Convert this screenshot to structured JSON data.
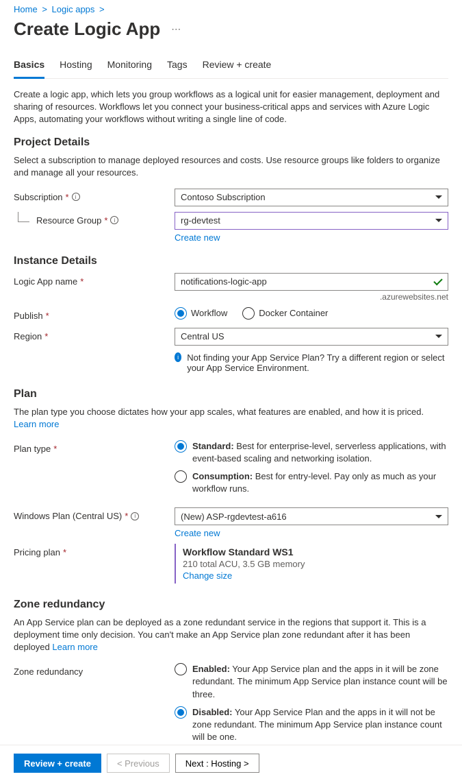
{
  "breadcrumb": {
    "home": "Home",
    "logic_apps": "Logic apps"
  },
  "title": "Create Logic App",
  "tabs": {
    "basics": "Basics",
    "hosting": "Hosting",
    "monitoring": "Monitoring",
    "tags": "Tags",
    "review": "Review + create"
  },
  "intro": "Create a logic app, which lets you group workflows as a logical unit for easier management, deployment and sharing of resources. Workflows let you connect your business-critical apps and services with Azure Logic Apps, automating your workflows without writing a single line of code.",
  "project": {
    "heading": "Project Details",
    "desc": "Select a subscription to manage deployed resources and costs. Use resource groups like folders to organize and manage all your resources.",
    "subscription_label": "Subscription",
    "subscription_value": "Contoso Subscription",
    "rg_label": "Resource Group",
    "rg_value": "rg-devtest",
    "create_new": "Create new"
  },
  "instance": {
    "heading": "Instance Details",
    "name_label": "Logic App name",
    "name_value": "notifications-logic-app",
    "suffix": ".azurewebsites.net",
    "publish_label": "Publish",
    "publish_workflow": "Workflow",
    "publish_docker": "Docker Container",
    "region_label": "Region",
    "region_value": "Central US",
    "region_hint": "Not finding your App Service Plan? Try a different region or select your App Service Environment."
  },
  "plan": {
    "heading": "Plan",
    "desc": "The plan type you choose dictates how your app scales, what features are enabled, and how it is priced. ",
    "learn_more": "Learn more",
    "type_label": "Plan type",
    "standard_name": "Standard:",
    "standard_desc": " Best for enterprise-level, serverless applications, with event-based scaling and networking isolation.",
    "consumption_name": "Consumption:",
    "consumption_desc": " Best for entry-level. Pay only as much as your workflow runs.",
    "winplan_label": "Windows Plan (Central US)",
    "winplan_value": "(New) ASP-rgdevtest-a616",
    "create_new": "Create new",
    "pricing_label": "Pricing plan",
    "pricing_name": "Workflow Standard WS1",
    "pricing_desc": "210 total ACU, 3.5 GB memory",
    "change_size": "Change size"
  },
  "zone": {
    "heading": "Zone redundancy",
    "desc": "An App Service plan can be deployed as a zone redundant service in the regions that support it. This is a deployment time only decision. You can't make an App Service plan zone redundant after it has been deployed ",
    "learn_more": "Learn more",
    "label": "Zone redundancy",
    "enabled_name": "Enabled:",
    "enabled_desc": " Your App Service plan and the apps in it will be zone redundant. The minimum App Service plan instance count will be three.",
    "disabled_name": "Disabled:",
    "disabled_desc": " Your App Service Plan and the apps in it will not be zone redundant. The minimum App Service plan instance count will be one."
  },
  "footer": {
    "review": "Review + create",
    "previous": "< Previous",
    "next": "Next : Hosting >"
  }
}
